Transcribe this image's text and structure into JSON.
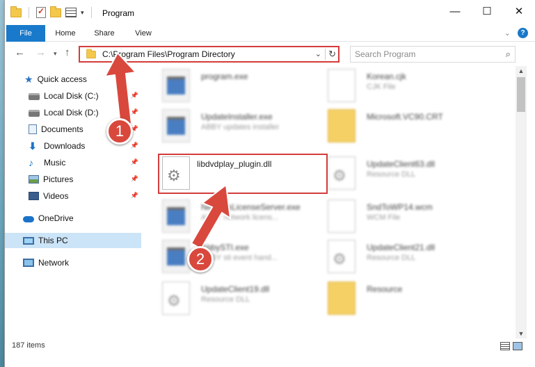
{
  "window": {
    "title": "Program",
    "controls": {
      "minimize": "—",
      "maximize": "☐",
      "close": "✕"
    }
  },
  "ribbon": {
    "tabs": [
      "File",
      "Home",
      "Share",
      "View"
    ],
    "help": "?"
  },
  "navigation": {
    "address": "C:\\Program Files\\Program Directory",
    "search_placeholder": "Search Program"
  },
  "sidebar": {
    "items": [
      {
        "label": "Quick access",
        "icon": "star-icon",
        "pinned": false
      },
      {
        "label": "Local Disk (C:)",
        "icon": "drive-icon",
        "pinned": true
      },
      {
        "label": "Local Disk (D:)",
        "icon": "drive-icon",
        "pinned": true
      },
      {
        "label": "Documents",
        "icon": "documents-icon",
        "pinned": true
      },
      {
        "label": "Downloads",
        "icon": "downloads-icon",
        "pinned": true
      },
      {
        "label": "Music",
        "icon": "music-icon",
        "pinned": true
      },
      {
        "label": "Pictures",
        "icon": "pictures-icon",
        "pinned": true
      },
      {
        "label": "Videos",
        "icon": "videos-icon",
        "pinned": true
      },
      {
        "label": "OneDrive",
        "icon": "onedrive-icon",
        "pinned": false
      },
      {
        "label": "This PC",
        "icon": "this-pc-icon",
        "pinned": false
      },
      {
        "label": "Network",
        "icon": "network-icon",
        "pinned": false
      }
    ]
  },
  "files": [
    {
      "name": "program.exe",
      "sub": "",
      "type": "exe"
    },
    {
      "name": "Korean.cjk",
      "sub": "CJK File",
      "type": "doc"
    },
    {
      "name": "UpdateInstaller.exe",
      "sub": "ABBY updates installer",
      "type": "exe"
    },
    {
      "name": "Microsoft.VC90.CRT",
      "sub": "",
      "type": "folder"
    },
    {
      "name": "libdvdplay_plugin.dll",
      "sub": "",
      "type": "dll"
    },
    {
      "name": "UpdateClient63.dll",
      "sub": "Resource DLL",
      "type": "dll"
    },
    {
      "name": "NetworkLicenseServer.exe",
      "sub": "ABBY network licens...",
      "type": "exe"
    },
    {
      "name": "SndToWP14.wcm",
      "sub": "WCM File",
      "type": "doc"
    },
    {
      "name": "AbbySTI.exe",
      "sub": "ABBY sti event hand...",
      "type": "exe"
    },
    {
      "name": "UpdateClient21.dll",
      "sub": "Resource DLL",
      "type": "dll"
    },
    {
      "name": "UpdateClient19.dll",
      "sub": "Resource DLL",
      "type": "dll"
    },
    {
      "name": "Resource",
      "sub": "",
      "type": "folder"
    }
  ],
  "status": {
    "item_count": "187 items"
  },
  "callouts": {
    "step1": "1",
    "step2": "2"
  },
  "colors": {
    "accent": "#1979ca",
    "highlight": "#d43b3b",
    "callout": "#d9483d"
  }
}
